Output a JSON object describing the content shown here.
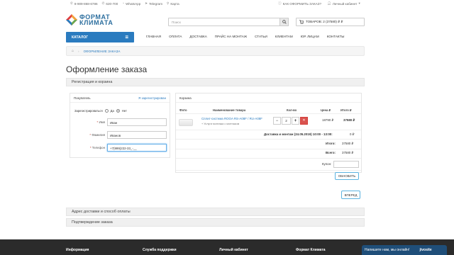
{
  "topbar": {
    "phone1": "8-909-868-6786",
    "phone2": "620-700",
    "whatsapp": "WhatsApp",
    "telegram": "Telegram",
    "map": "Карта",
    "how_to_order": "КАК ОФОРМИТЬ ЗАКАЗ?",
    "account": "Личный кабинет"
  },
  "logo": {
    "line1": "ФОРМАТ",
    "line2": "КЛИМАТА"
  },
  "search": {
    "placeholder": "Поиск"
  },
  "cart_button": {
    "label": "ТОВАРОВ: 2 (37580) ₽ ₽"
  },
  "nav": {
    "catalog": "КАТАЛОГ",
    "links": [
      "ГЛАВНАЯ",
      "ОПЛАТА",
      "ДОСТАВКА",
      "ПРАЙС НА МОНТАЖ",
      "СТАТЬИ",
      "КЛИЕНТАМ",
      "ЮР. ЛИЦАМ",
      "КОНТАКТЫ"
    ]
  },
  "breadcrumb": {
    "current": "ОФОРМЛЕНИЕ ЗАКАЗА"
  },
  "page_title": "Оформление заказа",
  "sections": {
    "registration": "Регистрация и корзина",
    "delivery": "Адрес доставки и способ оплаты",
    "confirm": "Подтверждение заказа"
  },
  "buyer": {
    "title": "Покупатель",
    "registered_link": "Я зарегистрирован",
    "register_label": "Зарегистрироваться",
    "yes": "Да",
    "no": "Нет",
    "fields": [
      {
        "label": "Имя",
        "value": "Иван"
      },
      {
        "label": "Фамилия",
        "value": "Иванов"
      },
      {
        "label": "Телефон",
        "value": "+7(999)222-33_-__"
      }
    ]
  },
  "cart": {
    "title": "Корзина",
    "headers": {
      "photo": "Фото",
      "name": "Наименование товара",
      "qty": "Кол-во",
      "price": "Цена ₽",
      "total": "Итого ₽"
    },
    "item": {
      "name": "Сплит-система ROOA RS-A08F / RU-A08F",
      "sub": "+ Услуги монтажа с монтажом",
      "qty": "2",
      "price": "18790 ₽",
      "total": "37580 ₽"
    },
    "delivery_row": {
      "label": "Доставка и монтаж (24.05.2019) 10:00 - 13:00:",
      "value": "0 ₽"
    },
    "itogo_label": "Итого:",
    "itogo_value": "37580 ₽",
    "vsego_label": "Всего:",
    "vsego_value": "37580 ₽",
    "coupon_label": "Купон:",
    "update_button": "ОБНОВИТЬ"
  },
  "next_button": "ВПЕРЕД",
  "footer": {
    "cols": [
      "Информация",
      "Служба поддержки",
      "Личный кабинет",
      "Формат Климата"
    ]
  },
  "chat": {
    "text": "Напишите нам, мы онлайн!",
    "brand": "jivosite"
  },
  "colors": {
    "accent": "#2a7bbf",
    "danger": "#d9534f",
    "footer": "#2b2b2b",
    "chat": "#1f4e79"
  }
}
